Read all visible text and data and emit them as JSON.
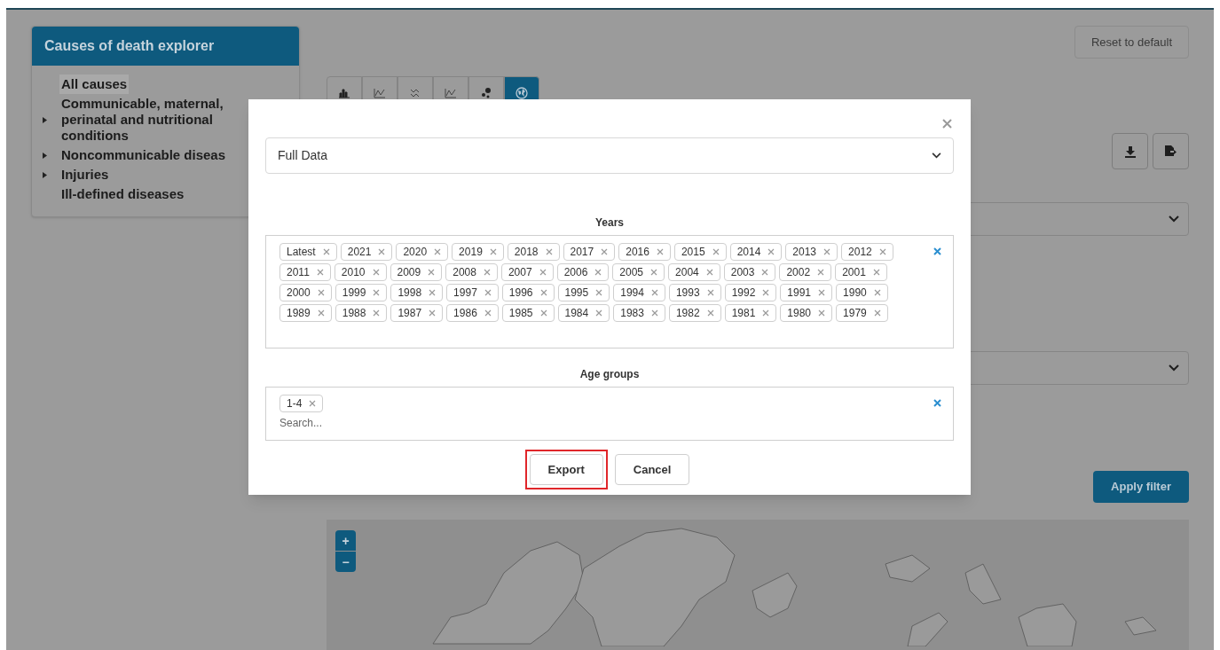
{
  "sidebar": {
    "title": "Causes of death explorer",
    "items": [
      {
        "label": "All causes",
        "expandable": false,
        "selected": true
      },
      {
        "label": "Communicable, maternal, perinatal and nutritional conditions",
        "expandable": true,
        "selected": false
      },
      {
        "label": "Noncommunicable diseas",
        "expandable": true,
        "selected": false
      },
      {
        "label": "Injuries",
        "expandable": true,
        "selected": false
      },
      {
        "label": "Ill-defined diseases",
        "expandable": false,
        "selected": false
      }
    ]
  },
  "chart_tabs": [
    {
      "kind": "bar",
      "selected": false
    },
    {
      "kind": "line",
      "selected": false
    },
    {
      "kind": "scatter",
      "selected": false
    },
    {
      "kind": "line",
      "selected": false
    },
    {
      "kind": "bubble",
      "selected": false
    },
    {
      "kind": "map",
      "selected": true
    }
  ],
  "reset_button": "Reset to default",
  "apply_button": "Apply filter",
  "map": {
    "zoom_in": "+",
    "zoom_out": "−"
  },
  "export_dialog": {
    "format": "Full Data",
    "years_label": "Years",
    "years": [
      "Latest",
      "2021",
      "2020",
      "2019",
      "2018",
      "2017",
      "2016",
      "2015",
      "2014",
      "2013",
      "2012",
      "2011",
      "2010",
      "2009",
      "2008",
      "2007",
      "2006",
      "2005",
      "2004",
      "2003",
      "2002",
      "2001",
      "2000",
      "1999",
      "1998",
      "1997",
      "1996",
      "1995",
      "1994",
      "1993",
      "1992",
      "1991",
      "1990",
      "1989",
      "1988",
      "1987",
      "1986",
      "1985",
      "1984",
      "1983",
      "1982",
      "1981",
      "1980",
      "1979"
    ],
    "age_groups_label": "Age groups",
    "age_groups": [
      "1-4"
    ],
    "age_search": {
      "placeholder": "Search..."
    },
    "buttons": [
      {
        "label": "Export",
        "highlighted": true
      },
      {
        "label": "Cancel",
        "highlighted": false
      }
    ]
  }
}
